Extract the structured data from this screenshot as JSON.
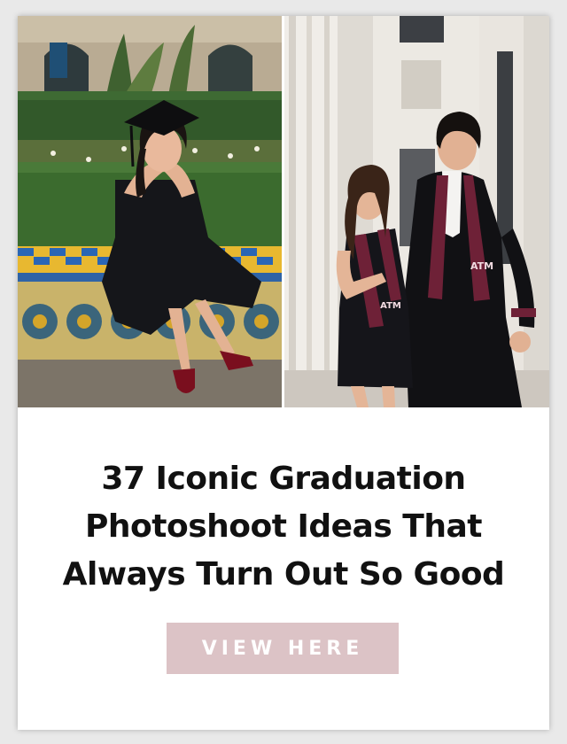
{
  "card": {
    "title_lines": [
      "37 Iconic Graduation",
      "Photoshoot Ideas That",
      "Always Turn Out So Good"
    ],
    "cta_label": "VIEW HERE"
  },
  "colors": {
    "button_bg": "#dcc3c6",
    "title_text": "#111111",
    "gown_maroon": "#6e2137"
  }
}
